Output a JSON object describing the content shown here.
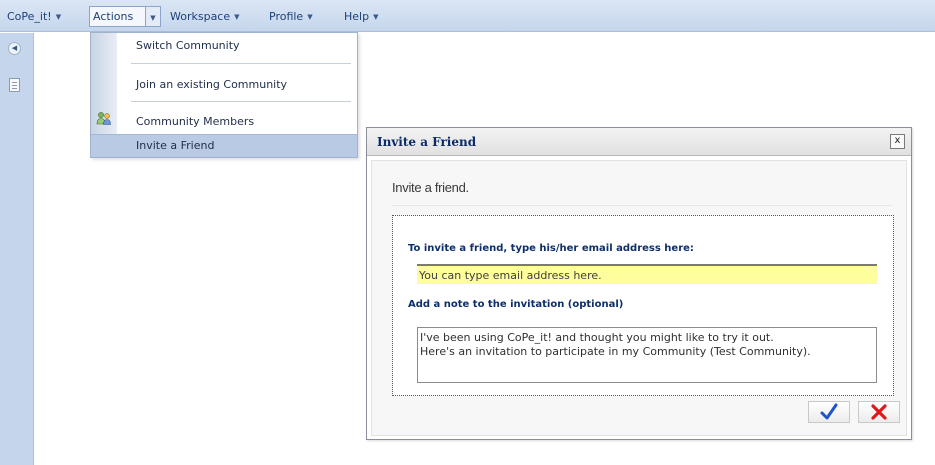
{
  "menubar": {
    "items": [
      {
        "label": "CoPe_it!"
      },
      {
        "label": "Actions"
      },
      {
        "label": "Workspace"
      },
      {
        "label": "Profile"
      },
      {
        "label": "Help"
      }
    ],
    "arrow": "▼"
  },
  "sidebar": {
    "collapse_icon": "◀",
    "page_icon": "document-icon"
  },
  "actions_menu": {
    "items": [
      {
        "label": "Switch Community"
      },
      {
        "label": "Join an existing Community"
      },
      {
        "label": "Community Members",
        "icon": "users-icon"
      },
      {
        "label": "Invite a Friend"
      }
    ],
    "highlighted": "Invite a Friend"
  },
  "dialog": {
    "title": "Invite a Friend",
    "close": "x",
    "heading": "Invite a friend.",
    "email_label": "To invite a friend, type his/her email address here:",
    "email_value": "You can type email address here.",
    "note_label": "Add a note to the invitation (optional)",
    "note_value": "I've been using CoPe_it! and thought you might like to try it out.\nHere's an invitation to participate in my Community (Test Community).",
    "ok_icon": "checkmark-icon",
    "cancel_icon": "x-icon"
  },
  "colors": {
    "menubar": "#c5d6ec",
    "highlight": "#b9cbe4",
    "input_bg": "#fefe9c",
    "ok": "#1f55c8",
    "cancel": "#e0181a"
  }
}
